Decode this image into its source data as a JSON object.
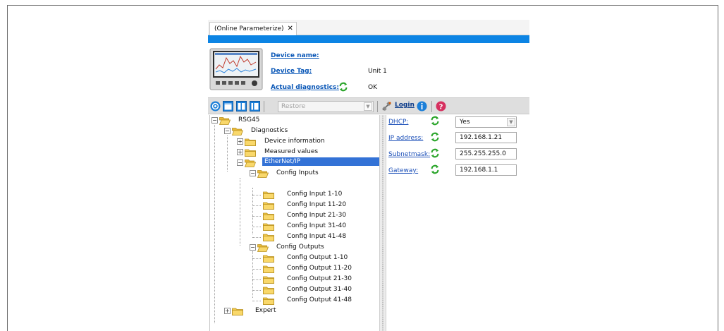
{
  "tab": {
    "label": "(Online Parameterize)",
    "close": "✕"
  },
  "header": {
    "device_name_label": "Device name:",
    "device_name_value": "",
    "device_tag_label": "Device Tag:",
    "device_tag_value": "Unit 1",
    "diagnostics_label": "Actual diagnostics:",
    "diagnostics_value": "OK"
  },
  "toolbar": {
    "restore_placeholder": "Restore",
    "login_label": "Login",
    "icons": [
      "home-icon",
      "view-icon",
      "view-split-icon",
      "view-single-icon",
      "connect-icon",
      "info-icon",
      "help-icon"
    ]
  },
  "tree": {
    "root": "RSG45",
    "diagnostics": "Diagnostics",
    "device_information": "Device information",
    "measured_values": "Measured values",
    "ethernet_ip": "EtherNet/IP",
    "config_inputs": "Config Inputs",
    "inputs": [
      "Config Input 1-10",
      "Config Input 11-20",
      "Config Input 21-30",
      "Config Input 31-40",
      "Config Input 41-48"
    ],
    "config_outputs": "Config Outputs",
    "outputs": [
      "Config Output 1-10",
      "Config Output 11-20",
      "Config Output 21-30",
      "Config Output 31-40",
      "Config Output 41-48"
    ],
    "expert": "Expert"
  },
  "properties": {
    "dhcp_label": "DHCP:",
    "dhcp_value": "Yes",
    "ip_label": "IP address:",
    "ip_value": "192.168.1.21",
    "subnet_label": "Subnetmask:",
    "subnet_value": "255.255.255.0",
    "gateway_label": "Gateway:",
    "gateway_value": "192.168.1.1"
  },
  "colors": {
    "accent_bar": "#0c84e4",
    "selection": "#3372d6",
    "link": "#0a57b7",
    "refresh_green": "#2aa52a"
  }
}
